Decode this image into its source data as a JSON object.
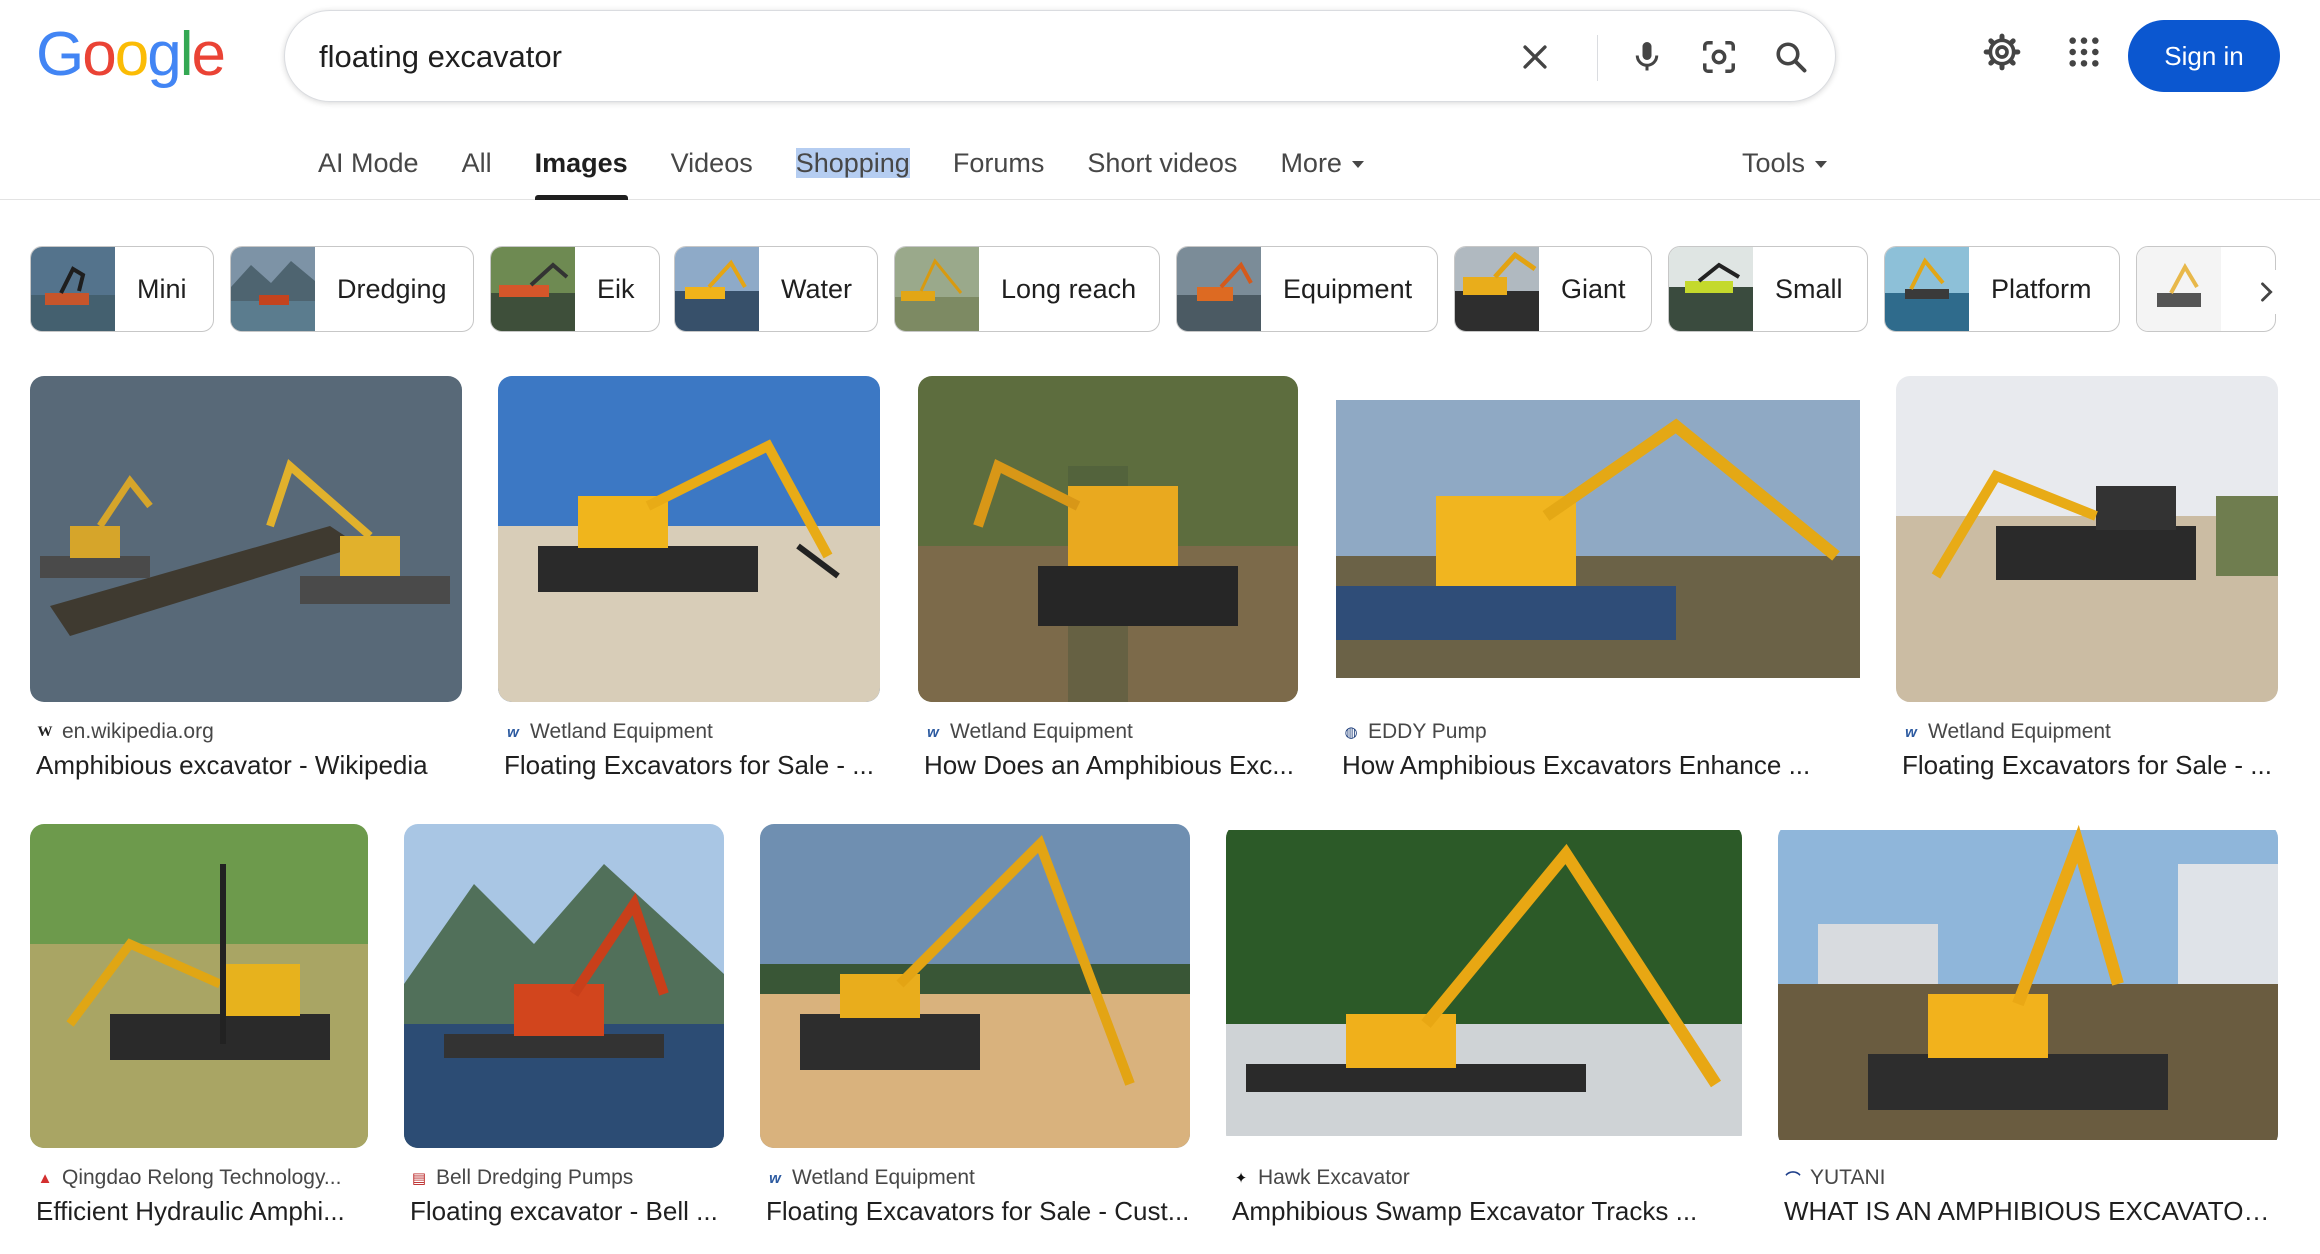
{
  "logo": {
    "text": "Google"
  },
  "search": {
    "query": "floating excavator"
  },
  "header": {
    "sign_in_label": "Sign in"
  },
  "tabs": [
    {
      "label": "AI Mode"
    },
    {
      "label": "All"
    },
    {
      "label": "Images"
    },
    {
      "label": "Videos"
    },
    {
      "label": "Shopping"
    },
    {
      "label": "Forums"
    },
    {
      "label": "Short videos"
    },
    {
      "label": "More"
    }
  ],
  "tools_label": "Tools",
  "chips": [
    {
      "label": "Mini"
    },
    {
      "label": "Dredging"
    },
    {
      "label": "Eik"
    },
    {
      "label": "Water"
    },
    {
      "label": "Long reach"
    },
    {
      "label": "Equipment"
    },
    {
      "label": "Giant"
    },
    {
      "label": "Small"
    },
    {
      "label": "Platform"
    },
    {
      "label": ""
    }
  ],
  "results": [
    {
      "source": "en.wikipedia.org",
      "title": "Amphibious excavator - Wikipedia",
      "favicon": "wikipedia-icon"
    },
    {
      "source": "Wetland Equipment",
      "title": "Floating Excavators for Sale - ...",
      "favicon": "wetland-equipment-icon"
    },
    {
      "source": "Wetland Equipment",
      "title": "How Does an Amphibious Exc...",
      "favicon": "wetland-equipment-icon"
    },
    {
      "source": "EDDY Pump",
      "title": "How Amphibious Excavators Enhance ...",
      "favicon": "eddy-pump-icon"
    },
    {
      "source": "Wetland Equipment",
      "title": "Floating Excavators for Sale - ...",
      "favicon": "wetland-equipment-icon"
    },
    {
      "source": "Qingdao Relong Technology...",
      "title": "Efficient Hydraulic Amphi...",
      "favicon": "relong-icon"
    },
    {
      "source": "Bell Dredging Pumps",
      "title": "Floating excavator - Bell ...",
      "favicon": "bell-dredging-icon"
    },
    {
      "source": "Wetland Equipment",
      "title": "Floating Excavators for Sale - Cust...",
      "favicon": "wetland-equipment-icon"
    },
    {
      "source": "Hawk Excavator",
      "title": "Amphibious Swamp Excavator Tracks ...",
      "favicon": "hawk-excavator-icon"
    },
    {
      "source": "YUTANI",
      "title": "WHAT IS AN AMPHIBIOUS EXCAVATOR?...",
      "favicon": "yutani-icon"
    }
  ],
  "colors": {
    "accent": "#0b57d0",
    "excavator_yellow": "#f2b51c",
    "excavator_orange": "#e0552a"
  }
}
